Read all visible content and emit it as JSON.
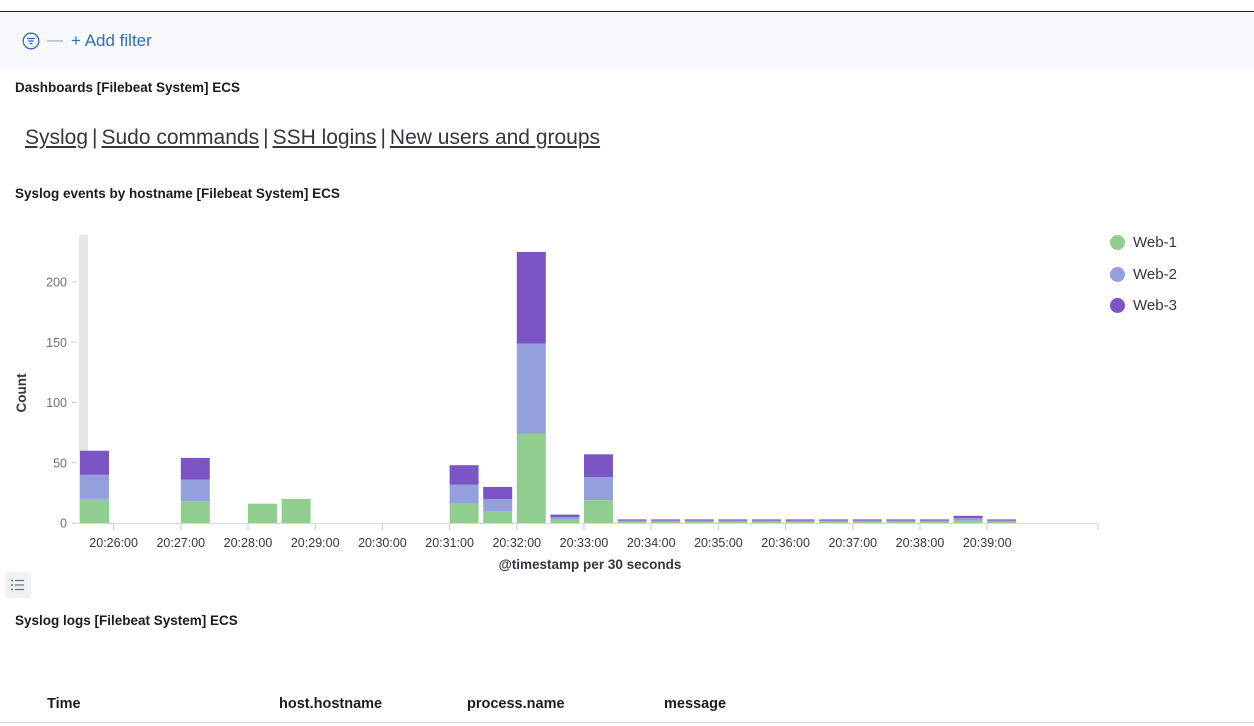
{
  "filter_bar": {
    "add_filter_label": "+ Add filter",
    "separator": "—",
    "icon": "filter-icon"
  },
  "dashboards_panel": {
    "title": "Dashboards [Filebeat System] ECS",
    "links": [
      "Syslog",
      "Sudo commands",
      "SSH logins",
      "New users and groups"
    ],
    "separator": "|"
  },
  "chart_panel": {
    "title": "Syslog events by hostname [Filebeat System] ECS"
  },
  "chart_data": {
    "type": "bar",
    "stacked": true,
    "title": "Syslog events by hostname [Filebeat System] ECS",
    "xlabel": "@timestamp per 30 seconds",
    "ylabel": "Count",
    "ylim": [
      0,
      240
    ],
    "yticks": [
      "0",
      "50",
      "100",
      "150",
      "200"
    ],
    "xtick_labels": [
      "20:26:00",
      "20:27:00",
      "20:28:00",
      "20:29:00",
      "20:30:00",
      "20:31:00",
      "20:32:00",
      "20:33:00",
      "20:34:00",
      "20:35:00",
      "20:36:00",
      "20:37:00",
      "20:38:00",
      "20:39:00"
    ],
    "categories": [
      "20:25:30",
      "20:26:00",
      "20:26:30",
      "20:27:00",
      "20:27:30",
      "20:28:00",
      "20:28:30",
      "20:29:00",
      "20:29:30",
      "20:30:00",
      "20:30:30",
      "20:31:00",
      "20:31:30",
      "20:32:00",
      "20:32:30",
      "20:33:00",
      "20:33:30",
      "20:34:00",
      "20:34:30",
      "20:35:00",
      "20:35:30",
      "20:36:00",
      "20:36:30",
      "20:37:00",
      "20:37:30",
      "20:38:00",
      "20:38:30",
      "20:39:00"
    ],
    "series": [
      {
        "name": "Web-1",
        "color": "#8fce8f",
        "values": [
          20,
          0,
          0,
          18,
          0,
          16,
          20,
          0,
          0,
          0,
          0,
          16,
          10,
          74,
          3,
          19,
          1,
          1,
          1,
          1,
          1,
          1,
          1,
          1,
          1,
          1,
          2,
          1
        ]
      },
      {
        "name": "Web-2",
        "color": "#959fdc",
        "values": [
          20,
          0,
          0,
          18,
          0,
          0,
          0,
          0,
          0,
          0,
          0,
          16,
          10,
          75,
          2,
          19,
          1,
          1,
          1,
          1,
          1,
          1,
          1,
          1,
          1,
          1,
          2,
          1
        ]
      },
      {
        "name": "Web-3",
        "color": "#7b55c4",
        "values": [
          20,
          0,
          0,
          18,
          0,
          0,
          0,
          0,
          0,
          0,
          0,
          16,
          10,
          76,
          2,
          19,
          1,
          1,
          1,
          1,
          1,
          1,
          1,
          1,
          1,
          1,
          2,
          1
        ]
      }
    ],
    "legend_position": "top-right",
    "grid": false
  },
  "logs_panel": {
    "title": "Syslog logs [Filebeat System] ECS",
    "columns": [
      "Time",
      "host.hostname",
      "process.name",
      "message"
    ]
  }
}
